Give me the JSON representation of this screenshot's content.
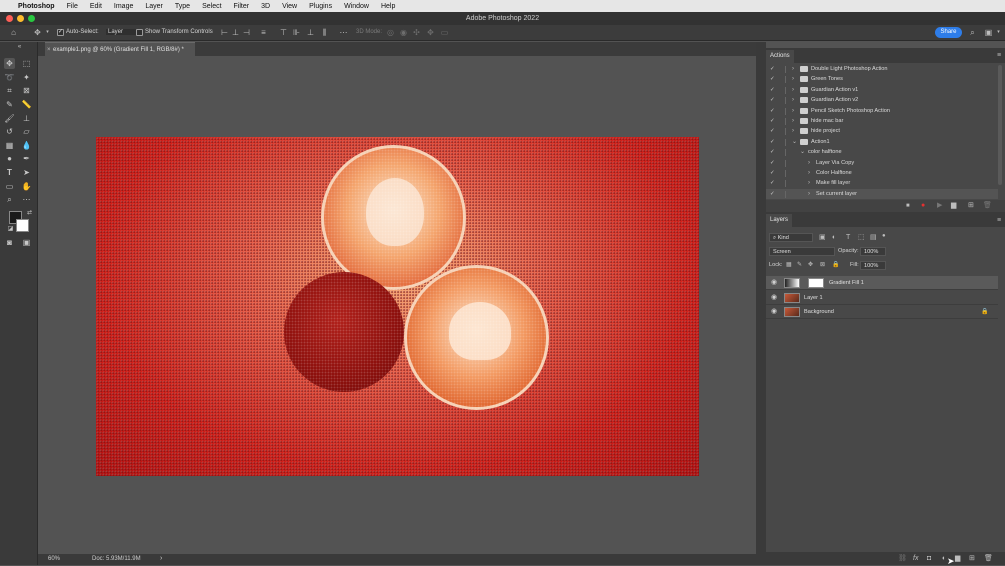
{
  "menubar": {
    "apple": "",
    "app": "Photoshop",
    "items": [
      "File",
      "Edit",
      "Image",
      "Layer",
      "Type",
      "Select",
      "Filter",
      "3D",
      "View",
      "Plugins",
      "Window",
      "Help"
    ]
  },
  "window": {
    "title": "Adobe Photoshop 2022"
  },
  "options": {
    "auto_select_label": "Auto-Select:",
    "auto_select_value": "Layer",
    "show_transform_label": "Show Transform Controls",
    "mode_3d": "3D Mode:",
    "share": "Share"
  },
  "document": {
    "tab": "example1.png @ 60% (Gradient Fill 1, RGB/8#) *"
  },
  "status": {
    "zoom": "60%",
    "doc": "Doc: 5.93M/11.9M",
    "arrow": "›"
  },
  "actions_panel": {
    "title": "Actions",
    "items": [
      {
        "label": "Double Light Photoshop Action",
        "indent": 0,
        "folder": true,
        "expanded": false
      },
      {
        "label": "Green Tones",
        "indent": 0,
        "folder": true,
        "expanded": false
      },
      {
        "label": "Guardian Action v1",
        "indent": 0,
        "folder": true,
        "expanded": false
      },
      {
        "label": "Guardian Action v2",
        "indent": 0,
        "folder": true,
        "expanded": false
      },
      {
        "label": "Pencil Sketch Photoshop Action",
        "indent": 0,
        "folder": true,
        "expanded": false
      },
      {
        "label": "hide mac bar",
        "indent": 0,
        "folder": true,
        "expanded": false
      },
      {
        "label": "hide project",
        "indent": 0,
        "folder": true,
        "expanded": false
      },
      {
        "label": "Action1",
        "indent": 0,
        "folder": true,
        "expanded": true
      },
      {
        "label": "color halftone",
        "indent": 1,
        "folder": false,
        "expanded": true
      },
      {
        "label": "Layer Via Copy",
        "indent": 2,
        "folder": false,
        "expanded": false
      },
      {
        "label": "Color Halftone",
        "indent": 2,
        "folder": false,
        "expanded": false
      },
      {
        "label": "Make fill layer",
        "indent": 2,
        "folder": false,
        "expanded": false
      },
      {
        "label": "Set current layer",
        "indent": 2,
        "folder": false,
        "expanded": false
      }
    ]
  },
  "layers_panel": {
    "title": "Layers",
    "filter_kind": "Kind",
    "blend_mode": "Screen",
    "opacity_label": "Opacity:",
    "opacity_value": "100%",
    "lock_label": "Lock:",
    "fill_label": "Fill:",
    "fill_value": "100%",
    "layers": [
      {
        "name": "Gradient Fill 1",
        "selected": true,
        "locked": false
      },
      {
        "name": "Layer 1",
        "selected": false,
        "locked": false
      },
      {
        "name": "Background",
        "selected": false,
        "locked": true
      }
    ]
  },
  "colors": {
    "accent": "#2e7de9",
    "image_red": "#d0201a",
    "image_orange": "#f9b07a"
  }
}
